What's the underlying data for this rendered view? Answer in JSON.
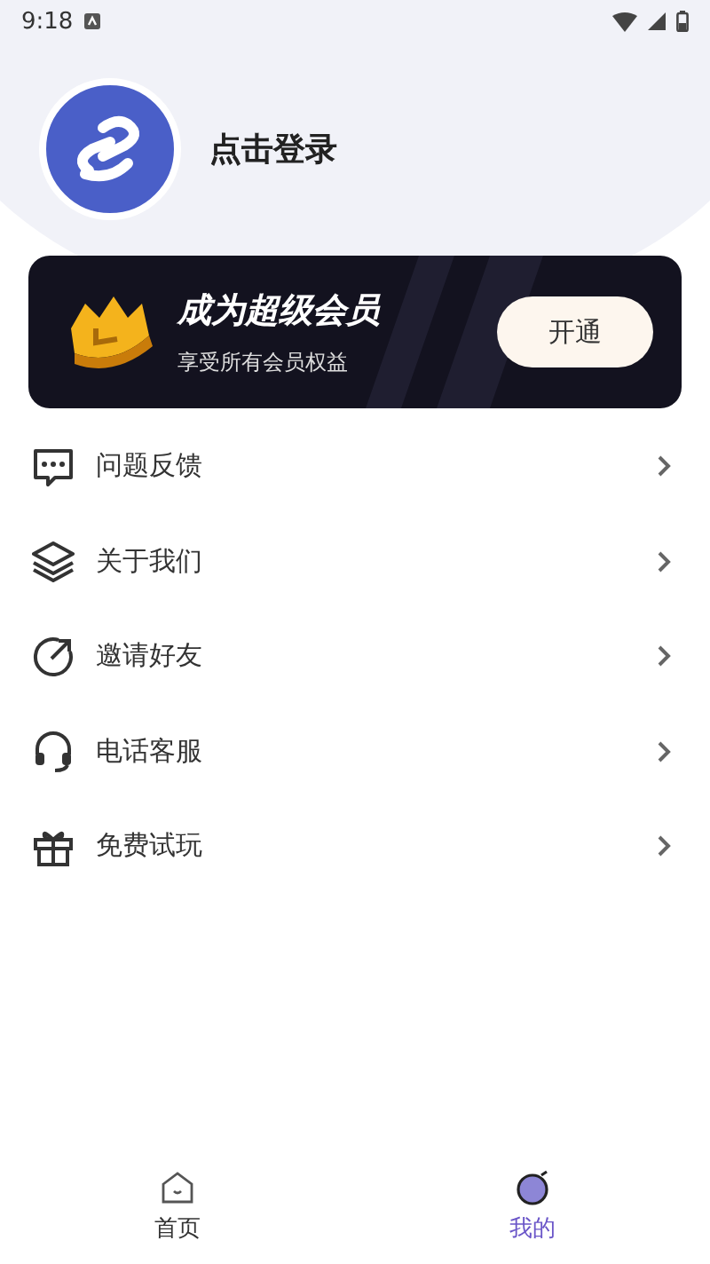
{
  "status_bar": {
    "time": "9:18"
  },
  "profile": {
    "login_label": "点击登录"
  },
  "vip_banner": {
    "title": "成为超级会员",
    "subtitle": "享受所有会员权益",
    "button": "开通"
  },
  "menu": [
    {
      "kind": "feedback",
      "label": "问题反馈"
    },
    {
      "kind": "about",
      "label": "关于我们"
    },
    {
      "kind": "invite",
      "label": "邀请好友"
    },
    {
      "kind": "support",
      "label": "电话客服"
    },
    {
      "kind": "trial",
      "label": "免费试玩"
    }
  ],
  "bottom_nav": [
    {
      "kind": "home",
      "label": "首页",
      "selected": false
    },
    {
      "kind": "mine",
      "label": "我的",
      "selected": true
    }
  ]
}
